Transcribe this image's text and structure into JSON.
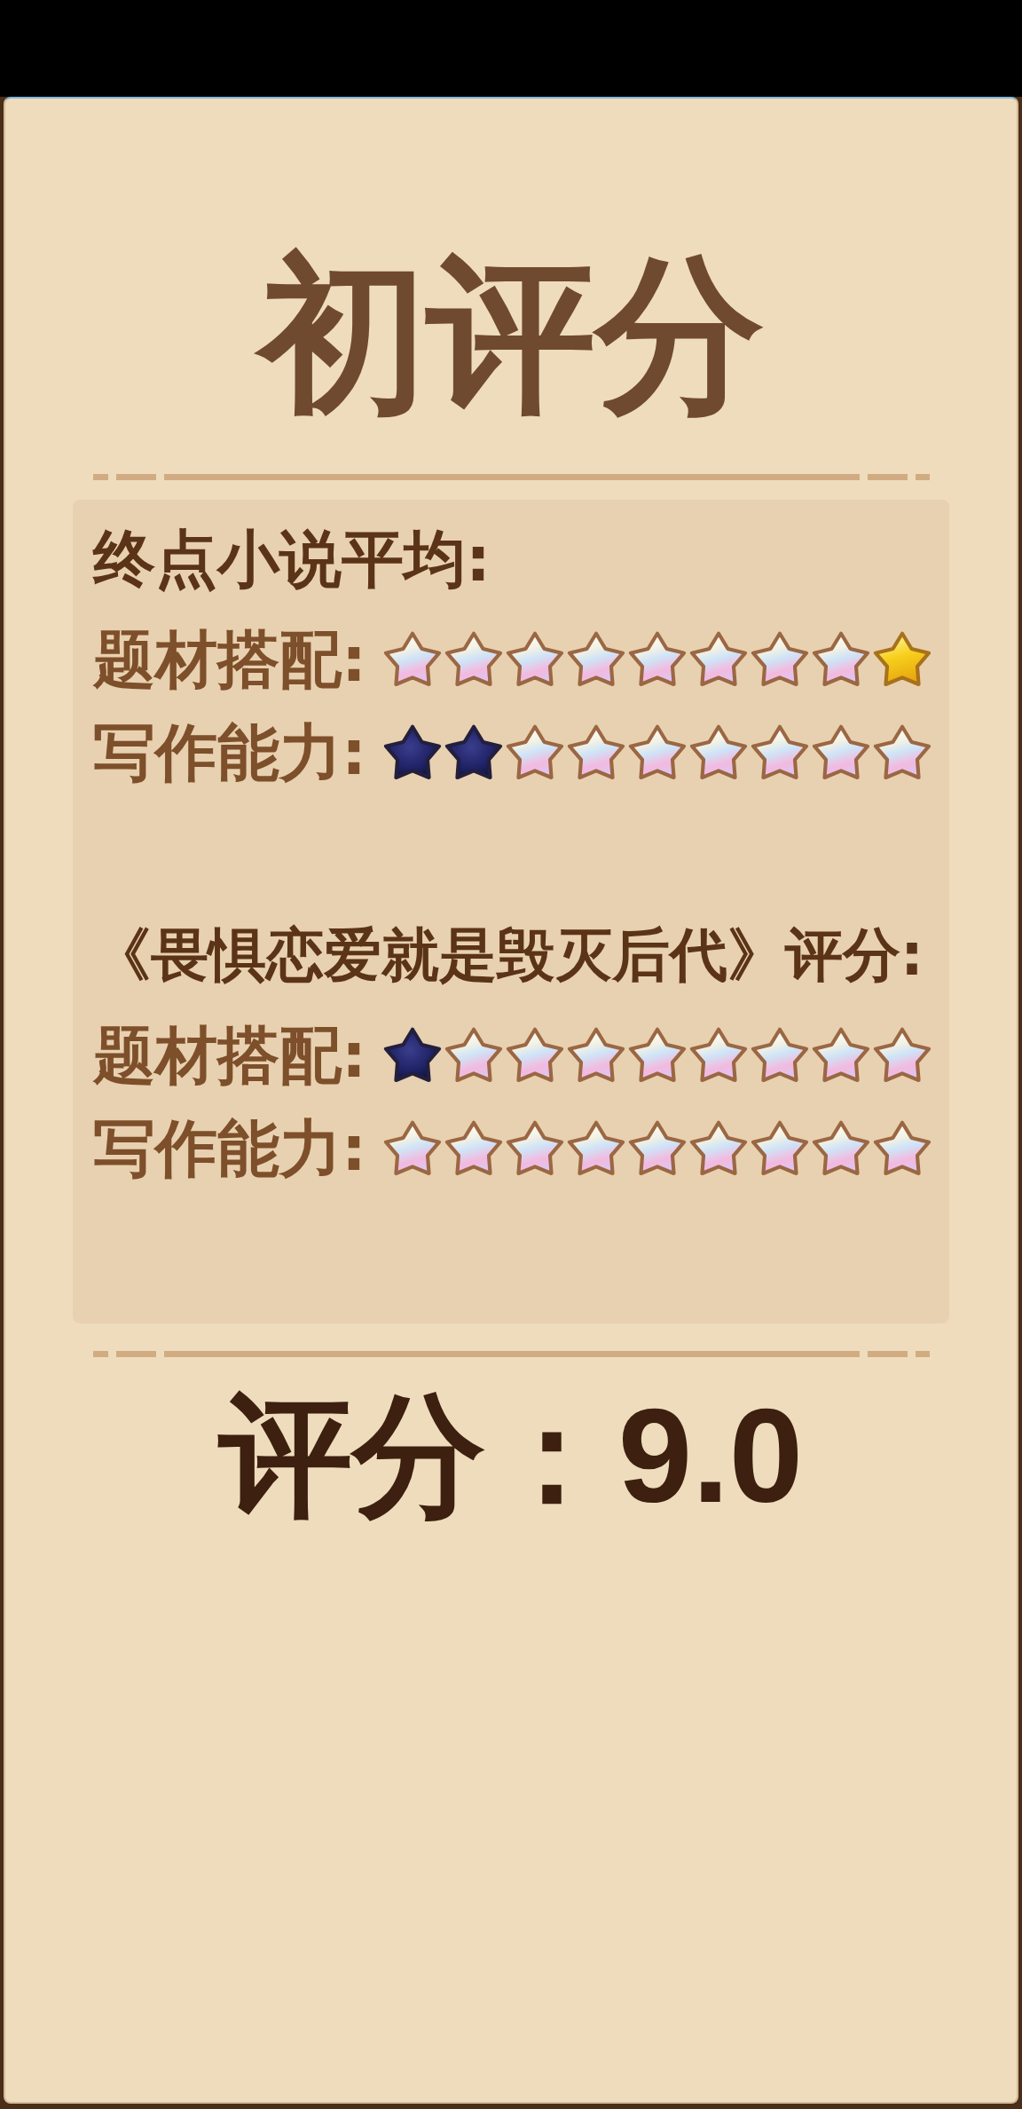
{
  "title": "初评分",
  "sections": [
    {
      "heading": "终点小说平均:",
      "rows": [
        {
          "label": "题材搭配:",
          "star_icons": [
            {
              "kind": "light"
            },
            {
              "kind": "light"
            },
            {
              "kind": "light"
            },
            {
              "kind": "light"
            },
            {
              "kind": "light"
            },
            {
              "kind": "light"
            },
            {
              "kind": "light"
            },
            {
              "kind": "light"
            },
            {
              "kind": "gold"
            }
          ]
        },
        {
          "label": "写作能力:",
          "star_icons": [
            {
              "kind": "dark"
            },
            {
              "kind": "dark"
            },
            {
              "kind": "light"
            },
            {
              "kind": "light"
            },
            {
              "kind": "light"
            },
            {
              "kind": "light"
            },
            {
              "kind": "light"
            },
            {
              "kind": "light"
            },
            {
              "kind": "light"
            }
          ]
        }
      ]
    },
    {
      "heading": "《畏惧恋爱就是毁灭后代》评分:",
      "rows": [
        {
          "label": "题材搭配:",
          "star_icons": [
            {
              "kind": "dark"
            },
            {
              "kind": "light"
            },
            {
              "kind": "light"
            },
            {
              "kind": "light"
            },
            {
              "kind": "light"
            },
            {
              "kind": "light"
            },
            {
              "kind": "light"
            },
            {
              "kind": "light"
            },
            {
              "kind": "light"
            }
          ]
        },
        {
          "label": "写作能力:",
          "star_icons": [
            {
              "kind": "light"
            },
            {
              "kind": "light"
            },
            {
              "kind": "light"
            },
            {
              "kind": "light"
            },
            {
              "kind": "light"
            },
            {
              "kind": "light"
            },
            {
              "kind": "light"
            },
            {
              "kind": "light"
            },
            {
              "kind": "light"
            }
          ]
        }
      ]
    }
  ],
  "score": {
    "label": "评分：",
    "value": "9.0"
  }
}
